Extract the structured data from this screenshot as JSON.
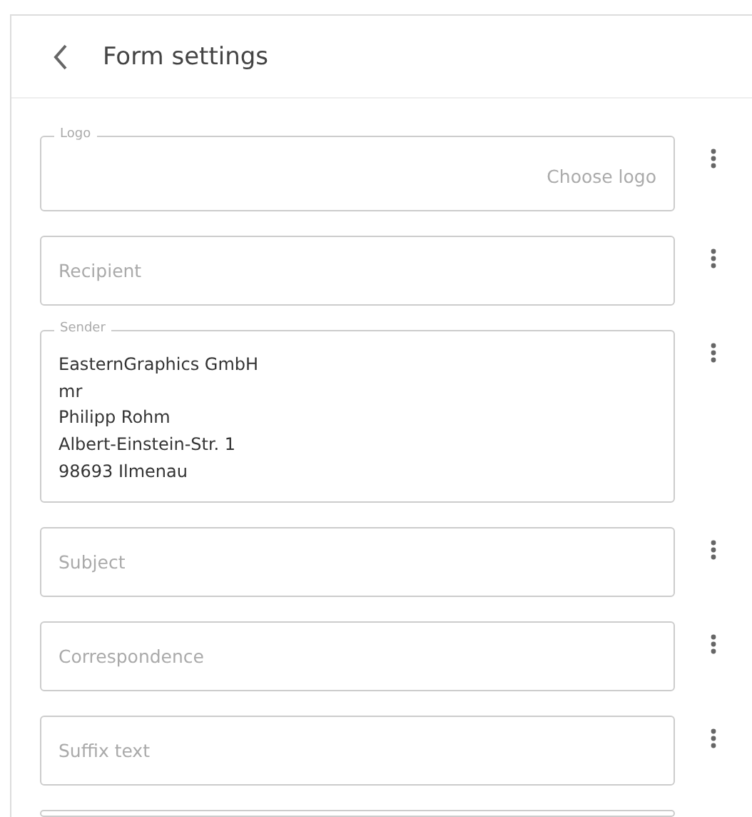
{
  "header": {
    "title": "Form settings"
  },
  "fields": [
    {
      "kind": "picker",
      "label": "Logo",
      "value": "Choose logo"
    },
    {
      "kind": "text",
      "placeholder": "Recipient"
    },
    {
      "kind": "multiline",
      "label": "Sender",
      "lines": [
        "EasternGraphics GmbH",
        "mr",
        "Philipp Rohm",
        "Albert-Einstein-Str. 1",
        "98693 Ilmenau"
      ]
    },
    {
      "kind": "text",
      "placeholder": "Subject"
    },
    {
      "kind": "text",
      "placeholder": "Correspondence"
    },
    {
      "kind": "text",
      "placeholder": "Suffix text"
    },
    {
      "kind": "partial"
    }
  ]
}
